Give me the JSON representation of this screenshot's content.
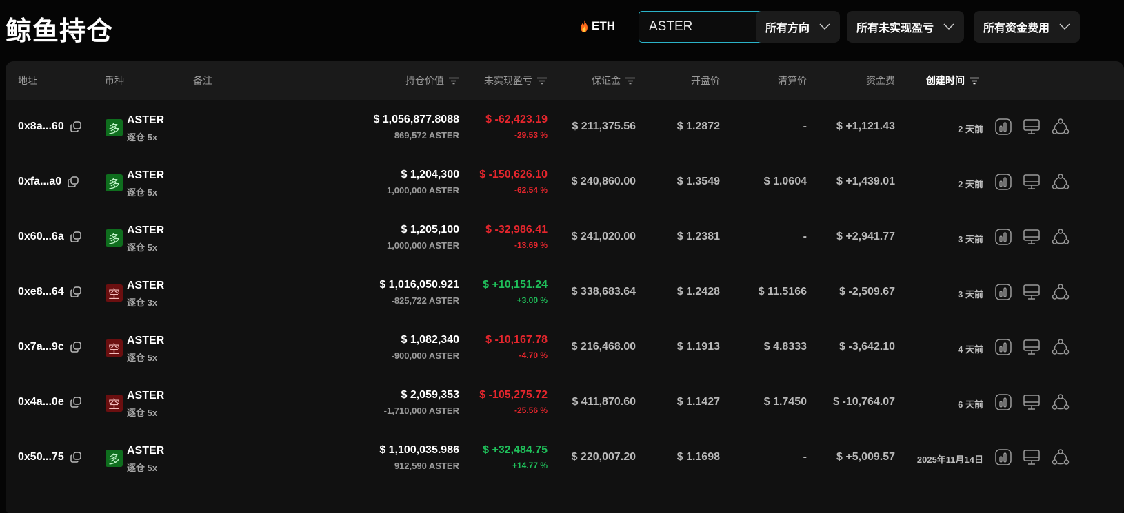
{
  "page_title": "鲸鱼持仓",
  "eth_tag": "ETH",
  "search": {
    "value": "ASTER"
  },
  "filters": [
    "所有方向",
    "所有未实现盈亏",
    "所有资金费用"
  ],
  "columns": {
    "address": "地址",
    "coin": "币种",
    "note": "备注",
    "position_value": "持仓价值",
    "unrealized_pnl": "未实现盈亏",
    "margin": "保证金",
    "open_price": "开盘价",
    "liq_price": "清算价",
    "funding": "资金费",
    "created": "创建时间"
  },
  "colors": {
    "accent": "#2bb3c8",
    "positive": "#1fbf5a",
    "negative": "#e5262d",
    "long_badge": "#0f6e1e",
    "short_badge": "#6b0f10"
  },
  "rows": [
    {
      "address": "0x8a...60",
      "side": "多",
      "side_type": "long",
      "symbol": "ASTER",
      "leverage": "逐仓 5x",
      "value": "$ 1,056,877.8088",
      "qty": "869,572 ASTER",
      "pnl": "$ -62,423.19",
      "pnl_pct": "-29.53 %",
      "pnl_sign": "neg",
      "margin": "$ 211,375.56",
      "open": "$ 1.2872",
      "liq": "-",
      "funding": "$ +1,121.43",
      "funding_sign": "pos",
      "created": "2 天前"
    },
    {
      "address": "0xfa...a0",
      "side": "多",
      "side_type": "long",
      "symbol": "ASTER",
      "leverage": "逐仓 5x",
      "value": "$ 1,204,300",
      "qty": "1,000,000 ASTER",
      "pnl": "$ -150,626.10",
      "pnl_pct": "-62.54 %",
      "pnl_sign": "neg",
      "margin": "$ 240,860.00",
      "open": "$ 1.3549",
      "liq": "$ 1.0604",
      "funding": "$ +1,439.01",
      "funding_sign": "pos",
      "created": "2 天前"
    },
    {
      "address": "0x60...6a",
      "side": "多",
      "side_type": "long",
      "symbol": "ASTER",
      "leverage": "逐仓 5x",
      "value": "$ 1,205,100",
      "qty": "1,000,000 ASTER",
      "pnl": "$ -32,986.41",
      "pnl_pct": "-13.69 %",
      "pnl_sign": "neg",
      "margin": "$ 241,020.00",
      "open": "$ 1.2381",
      "liq": "-",
      "funding": "$ +2,941.77",
      "funding_sign": "pos",
      "created": "3 天前"
    },
    {
      "address": "0xe8...64",
      "side": "空",
      "side_type": "short",
      "symbol": "ASTER",
      "leverage": "逐仓 3x",
      "value": "$ 1,016,050.921",
      "qty": "-825,722 ASTER",
      "pnl": "$ +10,151.24",
      "pnl_pct": "+3.00 %",
      "pnl_sign": "pos",
      "margin": "$ 338,683.64",
      "open": "$ 1.2428",
      "liq": "$ 11.5166",
      "funding": "$ -2,509.67",
      "funding_sign": "neg",
      "created": "3 天前"
    },
    {
      "address": "0x7a...9c",
      "side": "空",
      "side_type": "short",
      "symbol": "ASTER",
      "leverage": "逐仓 5x",
      "value": "$ 1,082,340",
      "qty": "-900,000 ASTER",
      "pnl": "$ -10,167.78",
      "pnl_pct": "-4.70 %",
      "pnl_sign": "neg",
      "margin": "$ 216,468.00",
      "open": "$ 1.1913",
      "liq": "$ 4.8333",
      "funding": "$ -3,642.10",
      "funding_sign": "neg",
      "created": "4 天前"
    },
    {
      "address": "0x4a...0e",
      "side": "空",
      "side_type": "short",
      "symbol": "ASTER",
      "leverage": "逐仓 5x",
      "value": "$ 2,059,353",
      "qty": "-1,710,000 ASTER",
      "pnl": "$ -105,275.72",
      "pnl_pct": "-25.56 %",
      "pnl_sign": "neg",
      "margin": "$ 411,870.60",
      "open": "$ 1.1427",
      "liq": "$ 1.7450",
      "funding": "$ -10,764.07",
      "funding_sign": "neg",
      "created": "6 天前"
    },
    {
      "address": "0x50...75",
      "side": "多",
      "side_type": "long",
      "symbol": "ASTER",
      "leverage": "逐仓 5x",
      "value": "$ 1,100,035.986",
      "qty": "912,590 ASTER",
      "pnl": "$ +32,484.75",
      "pnl_pct": "+14.77 %",
      "pnl_sign": "pos",
      "margin": "$ 220,007.20",
      "open": "$ 1.1698",
      "liq": "-",
      "funding": "$ +5,009.57",
      "funding_sign": "pos",
      "created": "2025年11月14日"
    }
  ]
}
